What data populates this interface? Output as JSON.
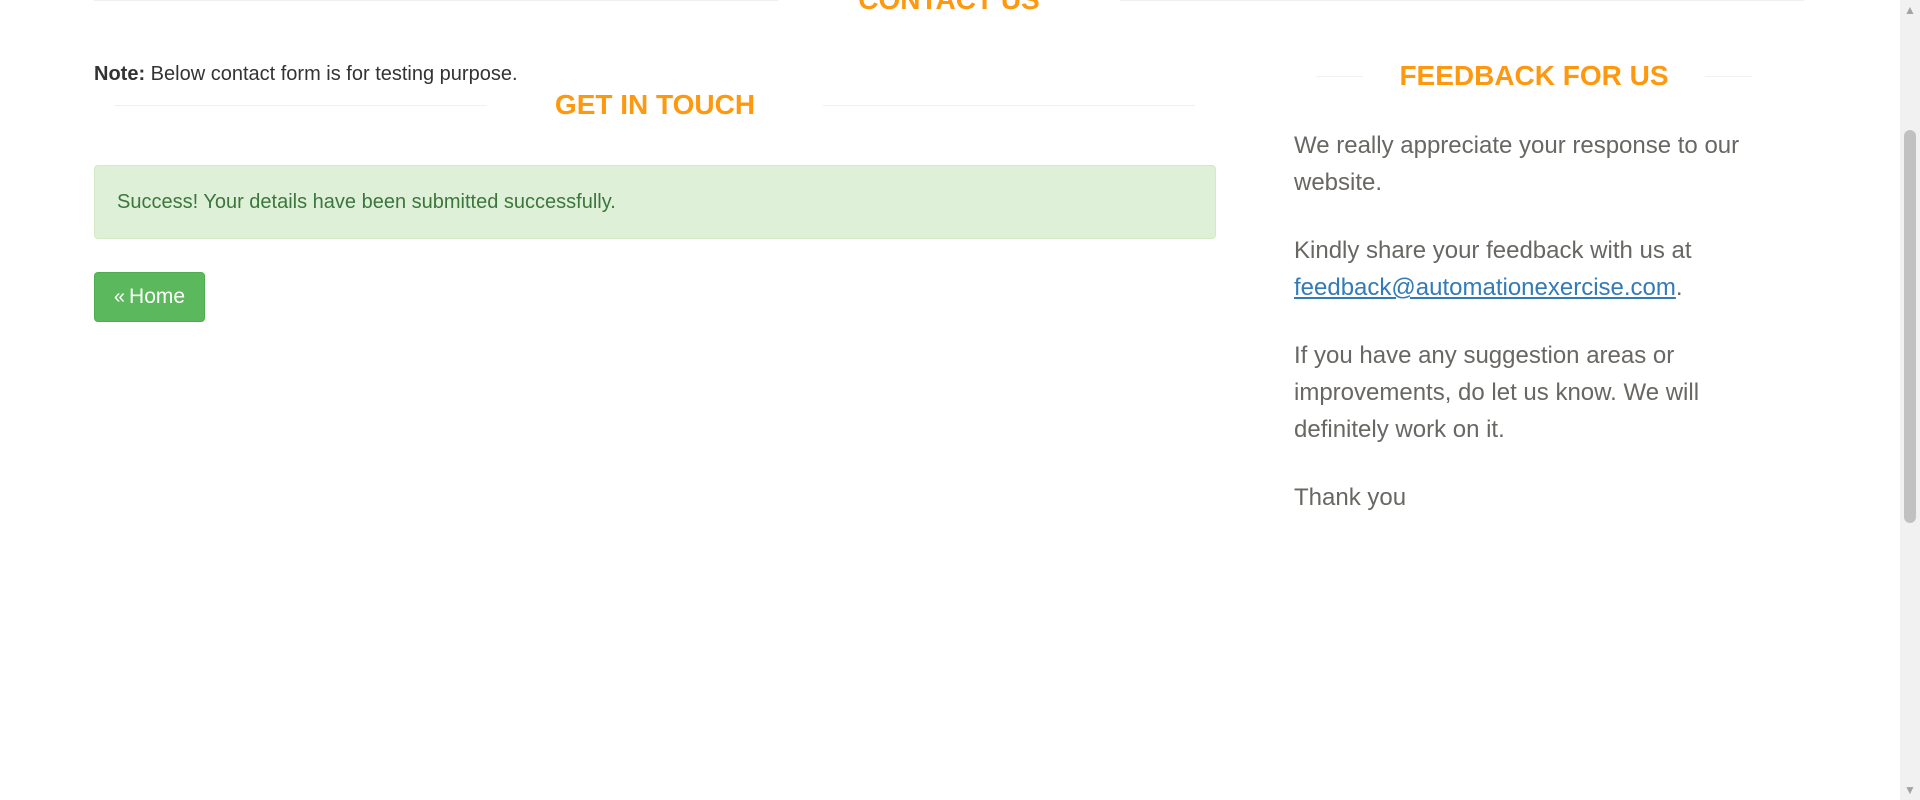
{
  "contact": {
    "heading": "CONTACT US",
    "note_label": "Note:",
    "note_text": " Below contact form is for testing purpose."
  },
  "get_in_touch": {
    "heading": "GET IN TOUCH",
    "success_message": "Success! Your details have been submitted successfully.",
    "home_button": "Home",
    "home_icon": "angle-double-left-icon"
  },
  "feedback": {
    "heading": "FEEDBACK FOR US",
    "paragraph1": "We really appreciate your response to our website.",
    "paragraph2_prefix": "Kindly share your feedback with us at ",
    "email": "feedback@automationexercise.com",
    "paragraph2_suffix": ".",
    "paragraph3": "If you have any suggestion areas or improvements, do let us know. We will definitely work on it.",
    "paragraph4": "Thank you"
  },
  "colors": {
    "accent": "#FE980F",
    "success_bg": "#dff0d8",
    "success_text": "#3c763d",
    "button_bg": "#5cb85c",
    "link": "#337ab7"
  }
}
